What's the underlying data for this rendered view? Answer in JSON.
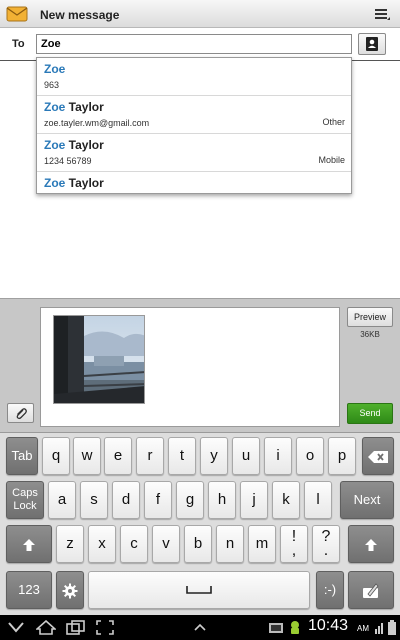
{
  "window": {
    "title": "New message"
  },
  "recipient": {
    "label": "To",
    "value": "Zoe"
  },
  "suggestions": [
    {
      "match": "Zoe",
      "rest": "",
      "detail": "963",
      "type": ""
    },
    {
      "match": "Zoe",
      "rest": " Taylor",
      "detail": "zoe.tayler.wm@gmail.com",
      "type": "Other"
    },
    {
      "match": "Zoe",
      "rest": " Taylor",
      "detail": "1234 56789",
      "type": "Mobile"
    },
    {
      "match": "Zoe",
      "rest": " Taylor",
      "detail": "",
      "type": ""
    }
  ],
  "compose": {
    "preview_label": "Preview",
    "size": "36KB",
    "send_label": "Send"
  },
  "keyboard": {
    "row1": [
      "Tab",
      "q",
      "w",
      "e",
      "r",
      "t",
      "y",
      "u",
      "i",
      "o",
      "p"
    ],
    "row2": [
      "Caps Lock",
      "a",
      "s",
      "d",
      "f",
      "g",
      "h",
      "j",
      "k",
      "l",
      "Next"
    ],
    "row3": [
      "z",
      "x",
      "c",
      "v",
      "b",
      "n",
      "m"
    ],
    "punct1": {
      "top": "!",
      "bottom": ","
    },
    "punct2": {
      "top": "?",
      "bottom": "."
    },
    "numbers_key": "123",
    "smiley_key": ":-)"
  },
  "status": {
    "time": "10:43",
    "ampm": "AM"
  },
  "colors": {
    "highlight": "#2a79b8",
    "send": "#3a9a20",
    "keyboard_bg": "#dddddd"
  }
}
